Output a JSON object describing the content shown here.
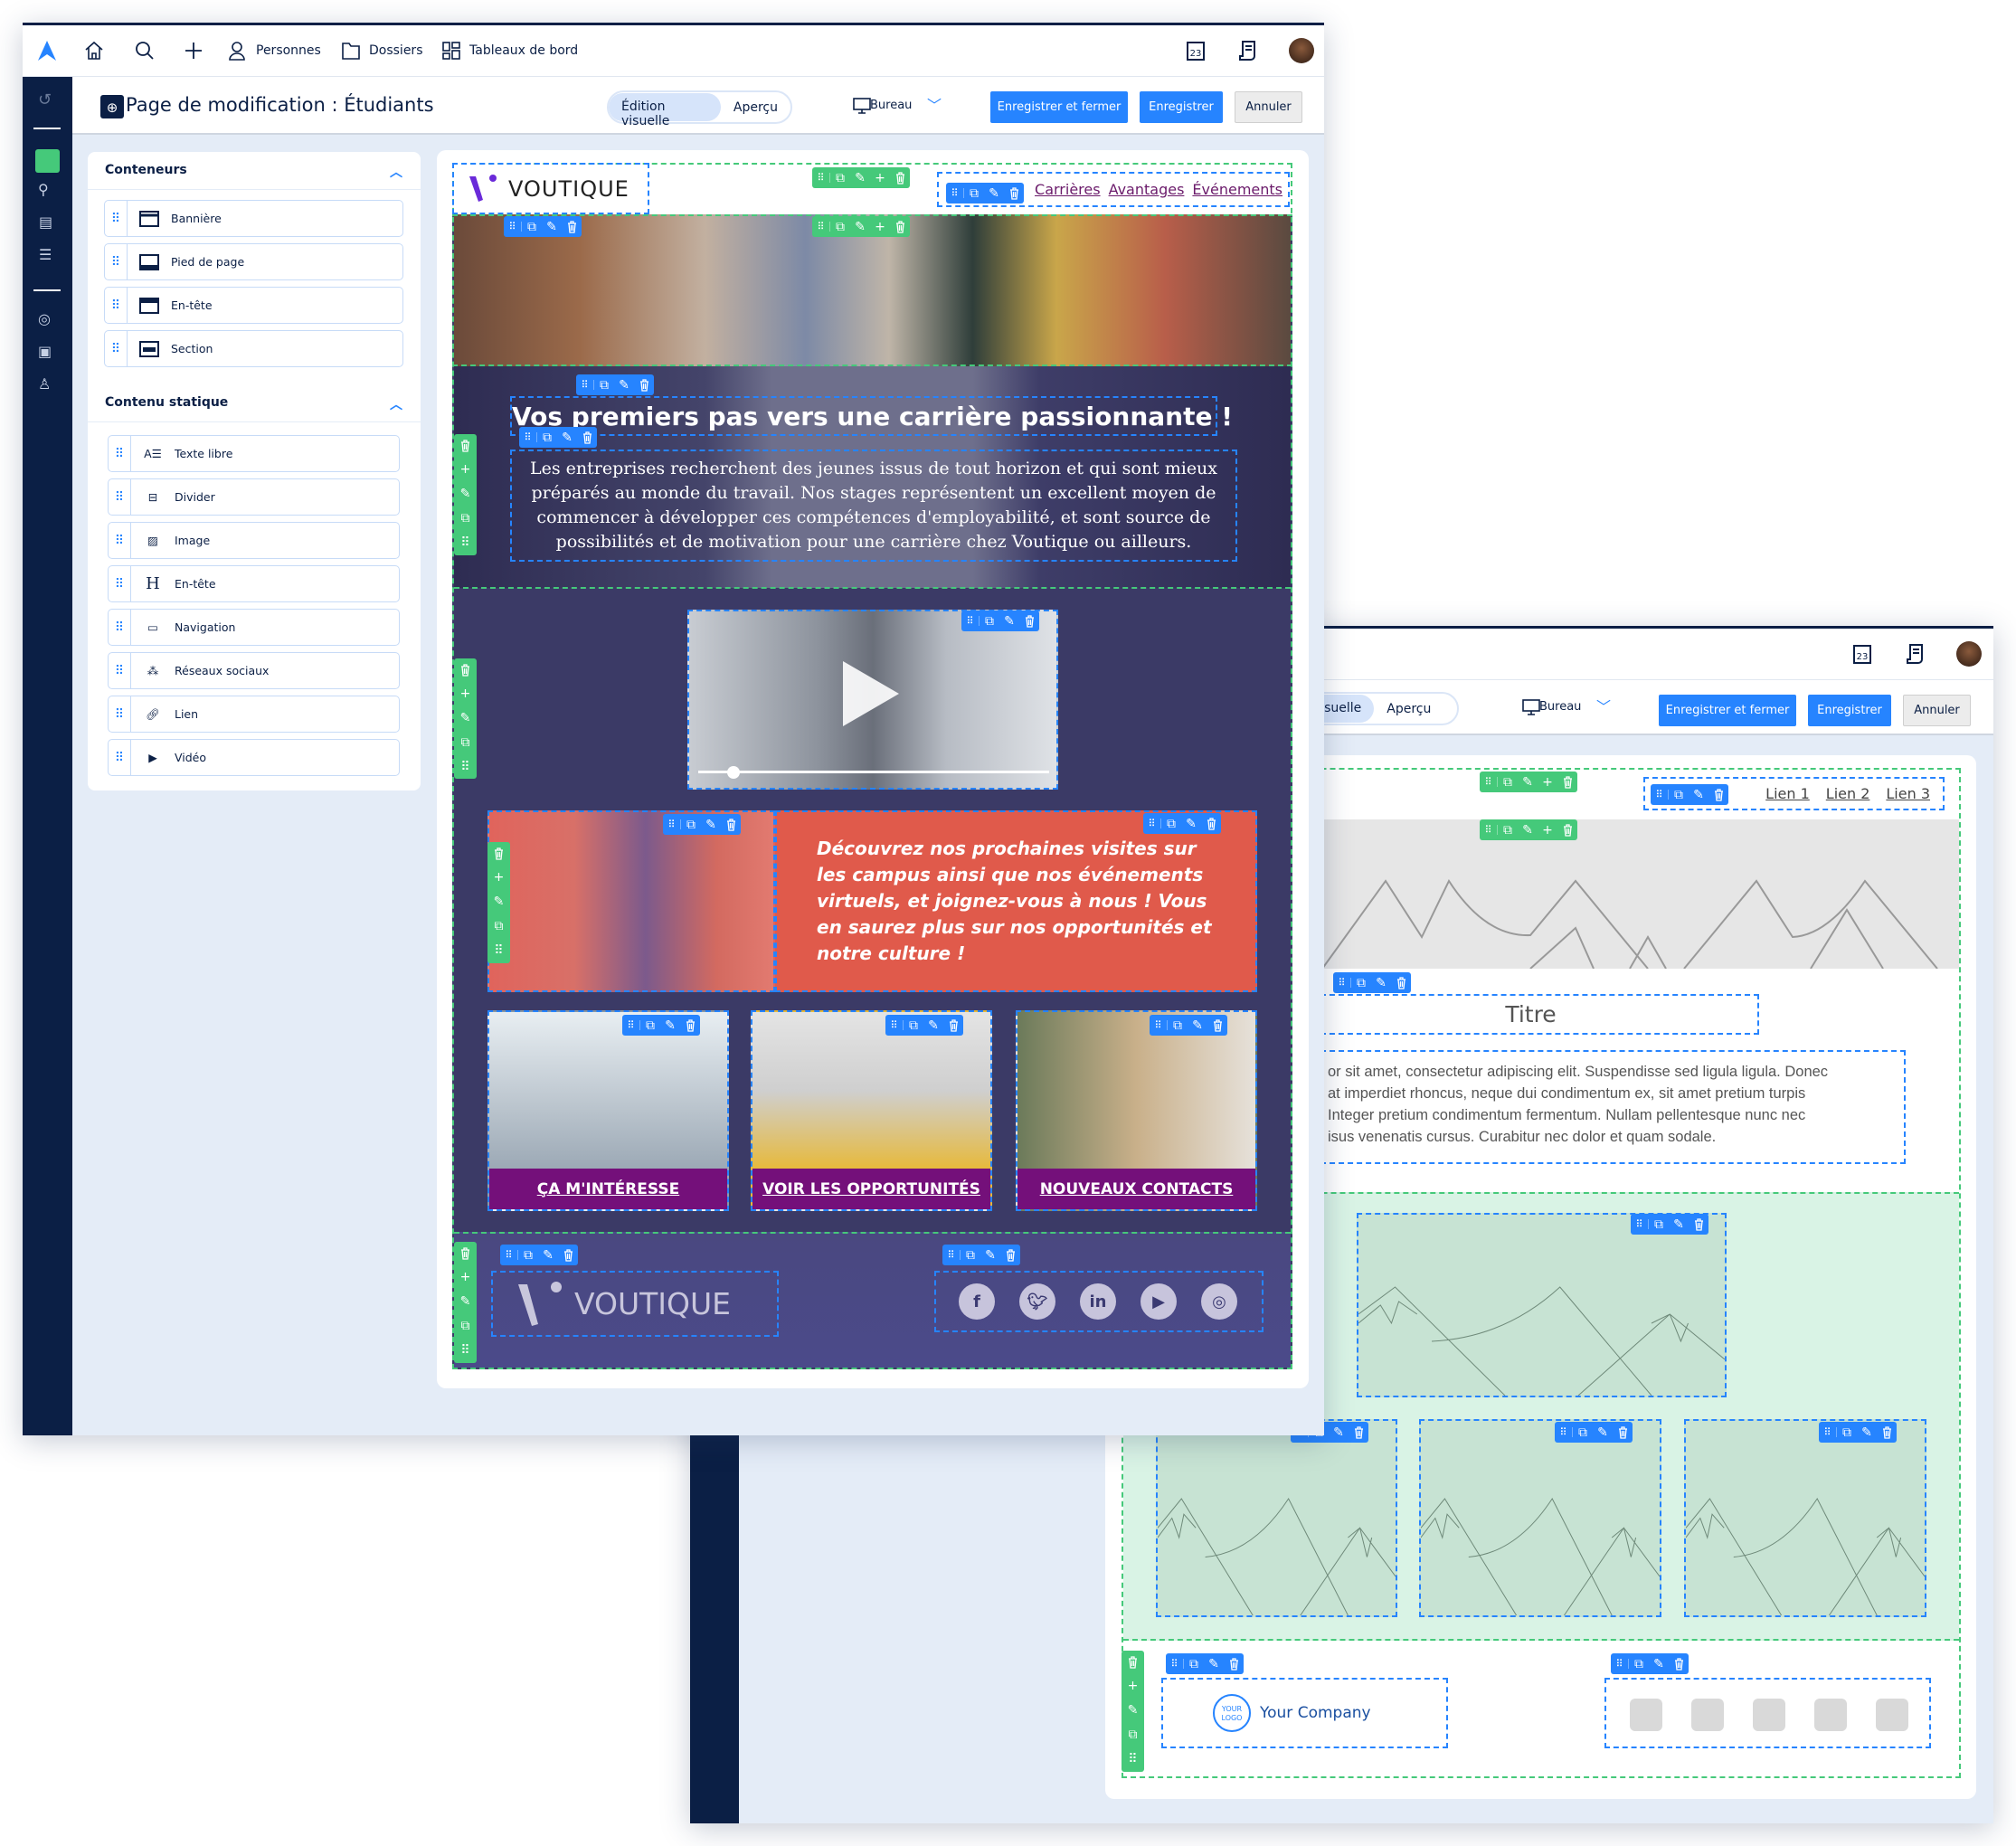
{
  "topnav": {
    "items": [
      {
        "label": "Personnes",
        "icon": "person-icon"
      },
      {
        "label": "Dossiers",
        "icon": "folder-icon"
      },
      {
        "label": "Tableaux de bord",
        "icon": "dashboard-icon"
      }
    ],
    "calendar_day": "23"
  },
  "header": {
    "title": "Page de modification : Étudiants",
    "toggle": {
      "visual": "Édition visuelle",
      "preview": "Aperçu"
    },
    "device": "Bureau",
    "save_close": "Enregistrer et fermer",
    "save": "Enregistrer",
    "cancel": "Annuler"
  },
  "left_panel": {
    "containers_title": "Conteneurs",
    "containers": [
      {
        "label": "Bannière",
        "icon": "banner-icon"
      },
      {
        "label": "Pied de page",
        "icon": "footer-icon"
      },
      {
        "label": "En-tête",
        "icon": "header-icon"
      },
      {
        "label": "Section",
        "icon": "section-icon"
      }
    ],
    "static_title": "Contenu statique",
    "static": [
      {
        "label": "Texte libre",
        "icon": "text-icon"
      },
      {
        "label": "Divider",
        "icon": "divider-icon"
      },
      {
        "label": "Image",
        "icon": "image-icon"
      },
      {
        "label": "En-tête",
        "icon": "heading-icon"
      },
      {
        "label": "Navigation",
        "icon": "navigation-icon"
      },
      {
        "label": "Réseaux sociaux",
        "icon": "social-icon"
      },
      {
        "label": "Lien",
        "icon": "link-icon"
      },
      {
        "label": "Vidéo",
        "icon": "video-icon"
      }
    ]
  },
  "preview": {
    "logo_text": "VOUTIQUE",
    "nav_links": [
      "Carrières",
      "Avantages",
      "Événements"
    ],
    "headline": "Vos premiers pas vers une carrière passionnante !",
    "paragraph": "Les entreprises recherchent des jeunes issus de tout horizon et qui sont mieux préparés au monde du travail. Nos stages représentent un excellent moyen de commencer à développer ces compétences d'employabilité, et sont source de possibilités et de motivation pour une carrière chez Voutique ou ailleurs.",
    "promo_text": "Découvrez nos prochaines visites sur les campus ainsi que nos événements virtuels, et joignez-vous à nous ! Vous en saurez plus sur nos opportunités et notre culture !",
    "ctas": [
      "ÇA M'INTÉRESSE",
      "VOIR LES OPPORTUNITÉS",
      "NOUVEAUX CONTACTS"
    ],
    "footer_logo_text": "VOUTIQUE",
    "social": [
      "facebook-icon",
      "twitter-icon",
      "linkedin-icon",
      "youtube-icon",
      "instagram-icon"
    ],
    "video_progress": 0.1,
    "colors": {
      "promo": "#e05a4b",
      "cta": "#74107a",
      "accent": "#2684ff",
      "container": "#45c97a"
    }
  },
  "back_window": {
    "toggle": {
      "visual": "Édition visuelle",
      "preview": "Aperçu"
    },
    "device": "Bureau",
    "save_close": "Enregistrer et fermer",
    "save": "Enregistrer",
    "cancel": "Annuler",
    "calendar_day": "23",
    "nav_links": [
      "Lien 1",
      "Lien 2",
      "Lien 3"
    ],
    "title": "Titre",
    "paragraph_lines": [
      "or sit amet, consectetur adipiscing elit. Suspendisse sed ligula ligula. Donec",
      "at imperdiet rhoncus, neque dui condimentum ex, sit amet pretium turpis",
      "Integer pretium condimentum fermentum. Nullam pellentesque nunc nec",
      "isus venenatis cursus. Curabitur nec dolor et quam sodale."
    ],
    "logo_badge": "YOUR LOGO",
    "company": "Your Company"
  }
}
